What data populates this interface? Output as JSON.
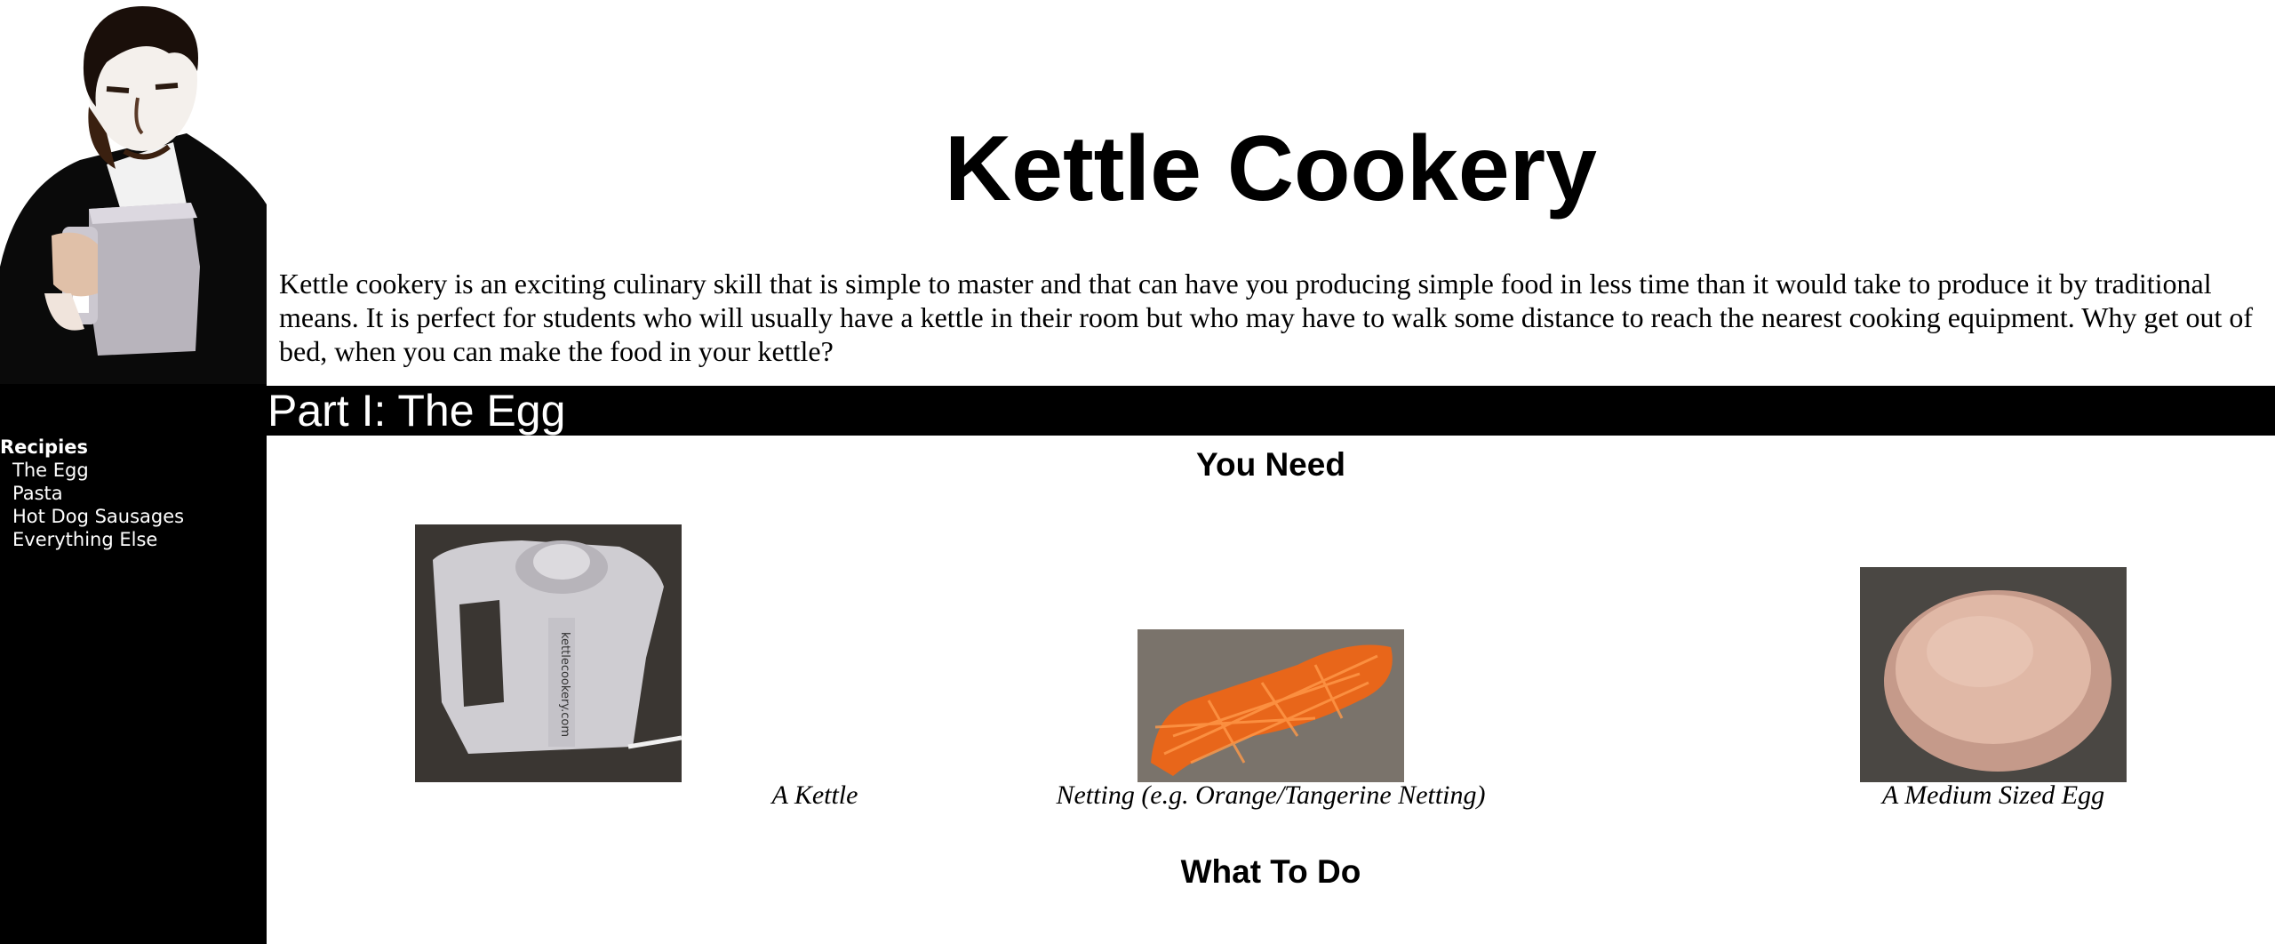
{
  "sidebar": {
    "portrait_icon": "man-holding-kettle-photo",
    "heading": "Recipies",
    "items": [
      {
        "label": "The Egg"
      },
      {
        "label": "Pasta"
      },
      {
        "label": "Hot Dog Sausages"
      },
      {
        "label": "Everything Else"
      }
    ]
  },
  "header": {
    "title": "Kettle Cookery",
    "intro": "Kettle cookery is an exciting culinary skill that is simple to master and that can have you producing simple food in less time than it would take to produce it by traditional means. It is perfect for students who will usually have a kettle in their room but who may have to walk some distance to reach the nearest cooking equipment. Why get out of bed, when you can make the food in your kettle?"
  },
  "section": {
    "title": "Part I: The Egg",
    "you_need": "You Need",
    "items": [
      {
        "caption": "A Kettle",
        "icon": "kettle-photo"
      },
      {
        "caption": "Netting (e.g. Orange/Tangerine Netting)",
        "icon": "netting-photo"
      },
      {
        "caption": "A Medium Sized Egg",
        "icon": "egg-photo"
      }
    ],
    "what_to_do": "What To Do"
  },
  "colors": {
    "sidebar_bg": "#000000",
    "part_bar_bg": "#000000",
    "part_bar_text": "#ffffff",
    "page_bg": "#ffffff"
  }
}
